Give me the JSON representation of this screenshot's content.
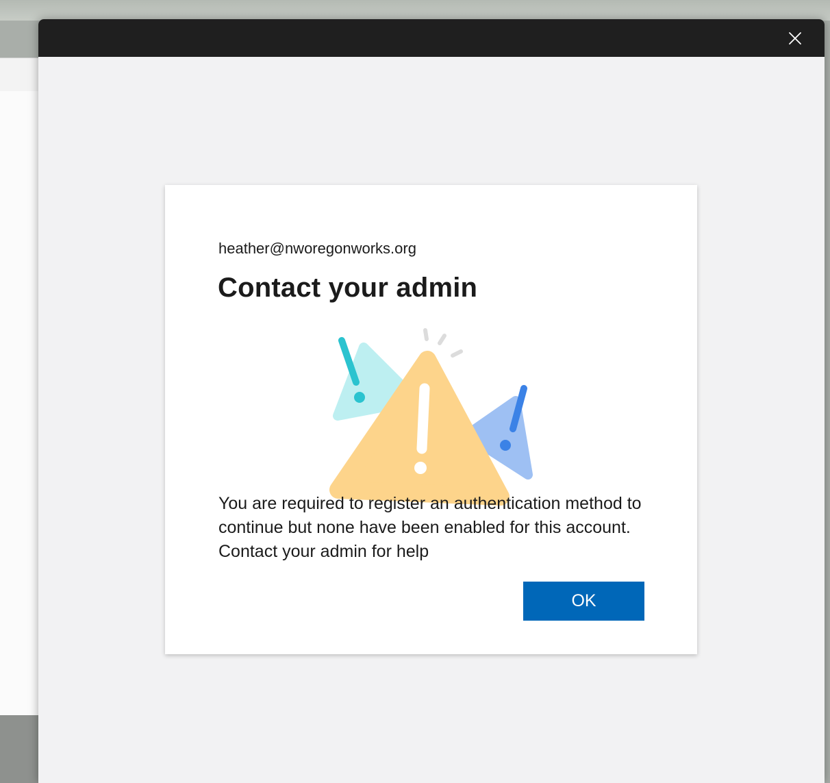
{
  "dialog": {
    "close_icon": "close-icon"
  },
  "card": {
    "identity": "heather@nworegonworks.org",
    "title": "Contact your admin",
    "illustration_icon": "warning-triangles-icon",
    "message": "You are required to register an authentication method to continue but none have been enabled for this account. Contact your admin for help",
    "ok_label": "OK"
  },
  "colors": {
    "titlebar": "#1f1f1f",
    "button_primary": "#0067b8",
    "warning_yellow": "#fdd48b",
    "accent_teal": "#2bc3cf",
    "accent_blue": "#3b82e6"
  }
}
